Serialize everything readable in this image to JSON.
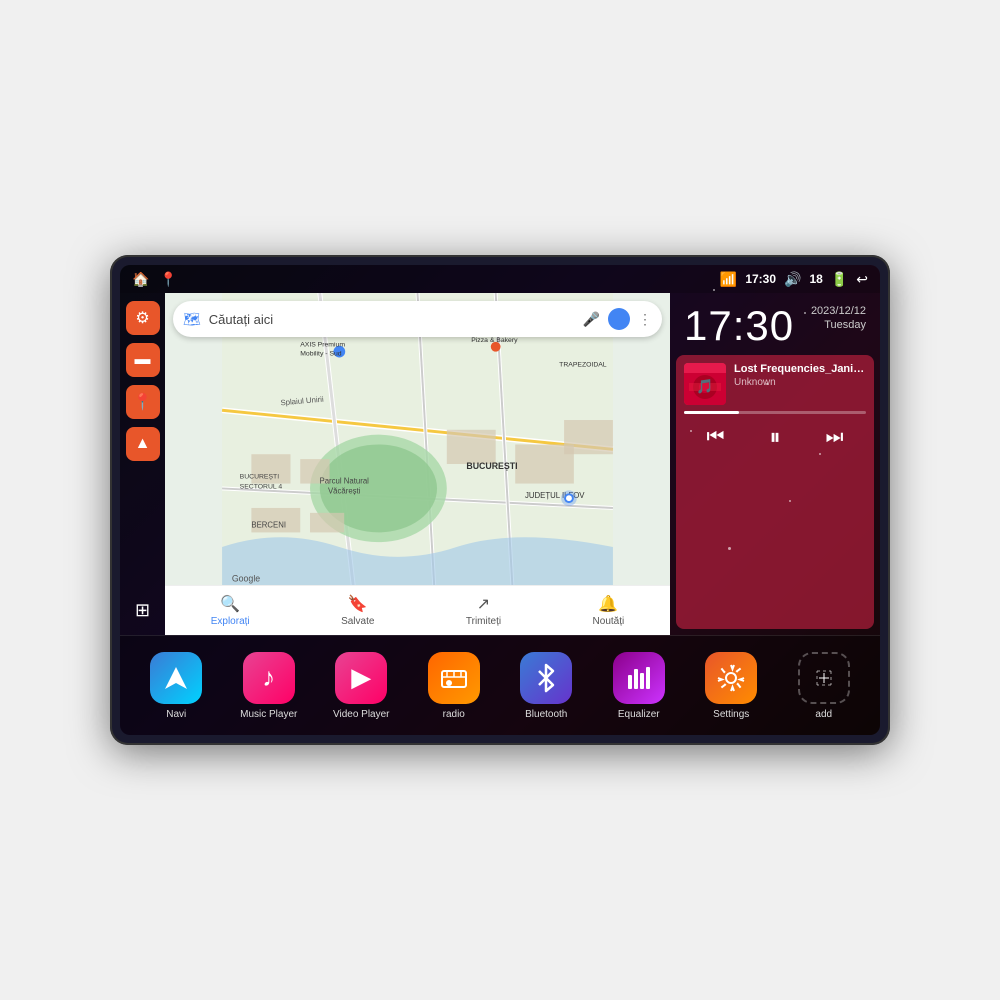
{
  "device": {
    "title": "Car Head Unit"
  },
  "statusBar": {
    "leftIcons": [
      "🏠",
      "📍"
    ],
    "time": "17:30",
    "signal": "📶",
    "volume": "🔊",
    "battery": "18",
    "batteryIcon": "🔋",
    "back": "↩"
  },
  "sidebar": {
    "items": [
      {
        "label": "Settings",
        "icon": "⚙",
        "color": "orange"
      },
      {
        "label": "Files",
        "icon": "📁",
        "color": "orange"
      },
      {
        "label": "Maps",
        "icon": "📍",
        "color": "orange"
      },
      {
        "label": "Navigation",
        "icon": "▲",
        "color": "orange"
      },
      {
        "label": "Apps",
        "icon": "⊞",
        "color": "transparent"
      }
    ]
  },
  "map": {
    "searchPlaceholder": "Căutați aici",
    "bottomItems": [
      {
        "label": "Explorați",
        "icon": "🔍",
        "active": true
      },
      {
        "label": "Salvate",
        "icon": "🔖",
        "active": false
      },
      {
        "label": "Trimiteți",
        "icon": "↗",
        "active": false
      },
      {
        "label": "Noutăți",
        "icon": "🔔",
        "active": false
      }
    ],
    "places": [
      "Parcul Natural Văcărești",
      "AXIS Premium Mobility - Sud",
      "Pizza & Bakery",
      "BUCUREȘTI SECTORUL 4",
      "BUCUREȘTI",
      "JUDEȚUL ILFOV",
      "BERCENI"
    ]
  },
  "clock": {
    "time": "17:30",
    "date": "2023/12/12",
    "day": "Tuesday"
  },
  "musicPlayer": {
    "title": "Lost Frequencies_Janie...",
    "artist": "Unknown",
    "progress": 30
  },
  "musicControls": {
    "prev": "⏮",
    "playPause": "⏸",
    "next": "⏭"
  },
  "appDock": {
    "apps": [
      {
        "id": "navi",
        "label": "Navi",
        "iconClass": "icon-navi",
        "icon": "▲"
      },
      {
        "id": "music-player",
        "label": "Music Player",
        "iconClass": "icon-music",
        "icon": "♪"
      },
      {
        "id": "video-player",
        "label": "Video Player",
        "iconClass": "icon-video",
        "icon": "▶"
      },
      {
        "id": "radio",
        "label": "radio",
        "iconClass": "icon-radio",
        "icon": "📻"
      },
      {
        "id": "bluetooth",
        "label": "Bluetooth",
        "iconClass": "icon-bluetooth",
        "icon": "⚡"
      },
      {
        "id": "equalizer",
        "label": "Equalizer",
        "iconClass": "icon-equalizer",
        "icon": "🎚"
      },
      {
        "id": "settings",
        "label": "Settings",
        "iconClass": "icon-settings",
        "icon": "⚙"
      },
      {
        "id": "add",
        "label": "add",
        "iconClass": "icon-add",
        "icon": "+"
      }
    ]
  }
}
